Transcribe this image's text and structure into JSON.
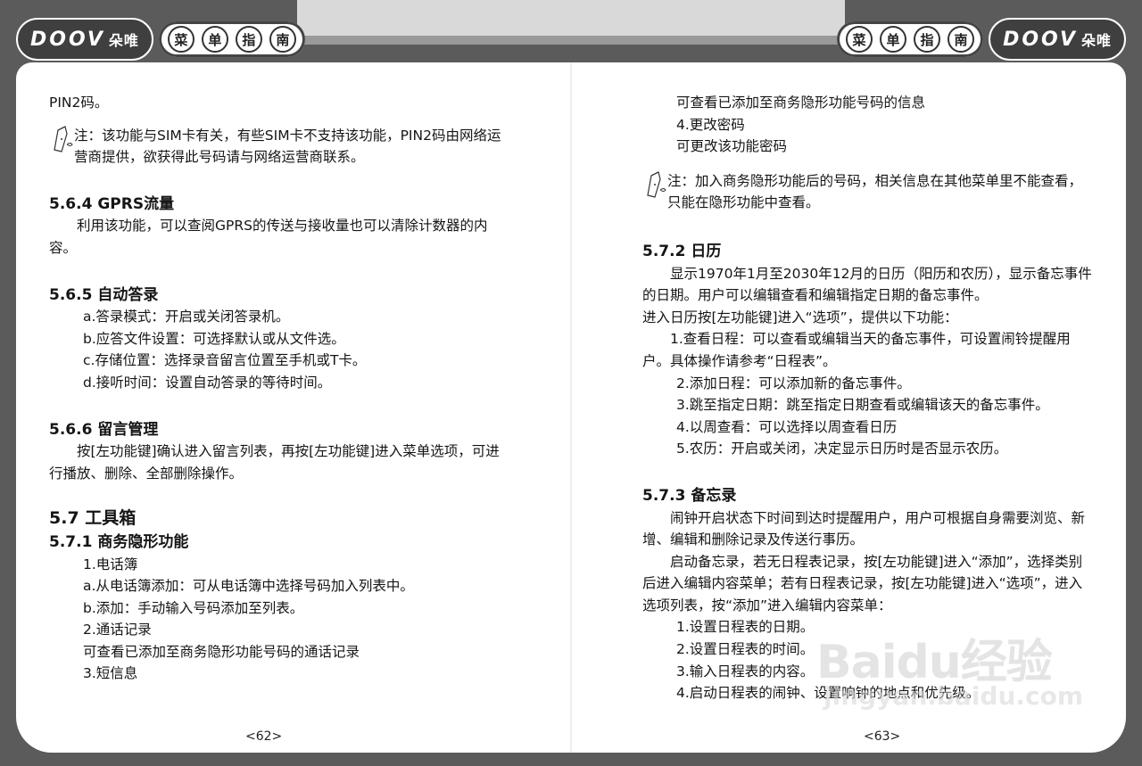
{
  "header": {
    "brand_latin": "DOOV",
    "brand_cn": "朵唯",
    "menu_chars": [
      "菜",
      "单",
      "指",
      "南"
    ]
  },
  "left": {
    "lines": [
      "PIN2码。"
    ],
    "note1": "注：该功能与SIM卡有关，有些SIM卡不支持该功能，PIN2码由网络运营商提供，欲获得此号码请与网络运营商联系。",
    "s564_title": "5.6.4 GPRS流量",
    "s564_body": "利用该功能，可以查阅GPRS的传送与接收量也可以清除计数器的内容。",
    "s565_title": "5.6.5 自动答录",
    "s565_items": [
      "a.答录模式：开启或关闭答录机。",
      "b.应答文件设置：可选择默认或从文件选。",
      "c.存储位置：选择录音留言位置至手机或T卡。",
      "d.接听时间：设置自动答录的等待时间。"
    ],
    "s566_title": "5.6.6 留言管理",
    "s566_body": "按[左功能键]确认进入留言列表，再按[左功能键]进入菜单选项，可进行播放、删除、全部删除操作。",
    "s57_title": "5.7 工具箱",
    "s571_title": "5.7.1 商务隐形功能",
    "s571_items": [
      "1.电话簿",
      "a.从电话簿添加：可从电话簿中选择号码加入列表中。",
      "b.添加：手动输入号码添加至列表。",
      "2.通话记录",
      "可查看已添加至商务隐形功能号码的通话记录",
      "3.短信息"
    ],
    "page_number": "<62>"
  },
  "right": {
    "top_items": [
      "可查看已添加至商务隐形功能号码的信息",
      "4.更改密码",
      "可更改该功能密码"
    ],
    "note2": "注：加入商务隐形功能后的号码，相关信息在其他菜单里不能查看，只能在隐形功能中查看。",
    "s572_title": "5.7.2 日历",
    "s572_body": "显示1970年1月至2030年12月的日历（阳历和农历），显示备忘事件的日期。用户可以编辑查看和编辑指定日期的备忘事件。",
    "s572_body2": "进入日历按[左功能键]进入“选项”，提供以下功能：",
    "s572_items": [
      "1.查看日程：可以查看或编辑当天的备忘事件，可设置闹铃提醒用户。具体操作请参考“日程表”。",
      "2.添加日程：可以添加新的备忘事件。",
      "3.跳至指定日期：跳至指定日期查看或编辑该天的备忘事件。",
      "4.以周查看：可以选择以周查看日历",
      "5.农历：开启或关闭，决定显示日历时是否显示农历。"
    ],
    "s573_title": "5.7.3 备忘录",
    "s573_body1": "闹钟开启状态下时间到达时提醒用户，用户可根据自身需要浏览、新增、编辑和删除记录及传送行事历。",
    "s573_body2": "启动备忘录，若无日程表记录，按[左功能键]进入“添加”，选择类别后进入编辑内容菜单；若有日程表记录，按[左功能键]进入“选项”，进入选项列表，按“添加”进入编辑内容菜单：",
    "s573_items": [
      "1.设置日程表的日期。",
      "2.设置日程表的时间。",
      "3.输入日程表的内容。",
      "4.启动日程表的闹钟、设置响钟的地点和优先级。"
    ],
    "page_number": "<63>"
  },
  "watermark": {
    "main": "Baidu经验",
    "sub": "jingyan.baidu.com"
  }
}
